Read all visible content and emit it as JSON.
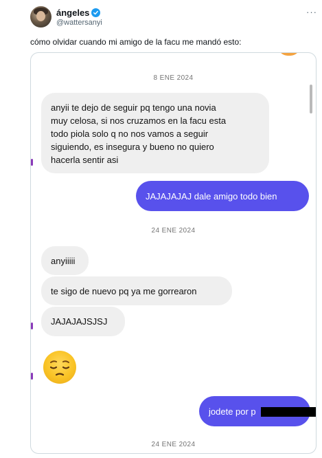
{
  "author": {
    "display_name": "ángeles",
    "handle": "@wattersanyi"
  },
  "more_label": "···",
  "tweet_text": "cómo olvidar cuando mi amigo de la facu me mandó esto:",
  "chat": {
    "date_1": "8 ENE 2024",
    "msg_1": "anyii te dejo de seguir pq tengo una novia muy celosa, si nos cruzamos en la facu esta todo piola solo q no nos vamos a seguir siguiendo, es insegura y bueno no quiero hacerla sentir asi",
    "msg_1_lines": [
      "anyii te dejo de seguir pq tengo una novia",
      "muy celosa, si nos cruzamos en la facu esta",
      "todo piola solo q no nos vamos a seguir",
      "siguiendo, es insegura y bueno no quiero",
      "hacerla sentir asi"
    ],
    "reply_1": "JAJAJAJAJ dale amigo todo bien",
    "date_2": "24 ENE 2024",
    "msg_2": "anyiiiii",
    "msg_3": "te sigo de nuevo pq ya me gorrearon",
    "msg_4": "JAJAJAJSJSJ",
    "emoji_name": "pensive-face",
    "reply_2": "jodete por p",
    "date_3": "24 ENE 2024"
  },
  "colors": {
    "outgoing_bubble": "#5851ec",
    "incoming_bubble": "#efefef",
    "verified_badge": "#1d9bf0"
  }
}
